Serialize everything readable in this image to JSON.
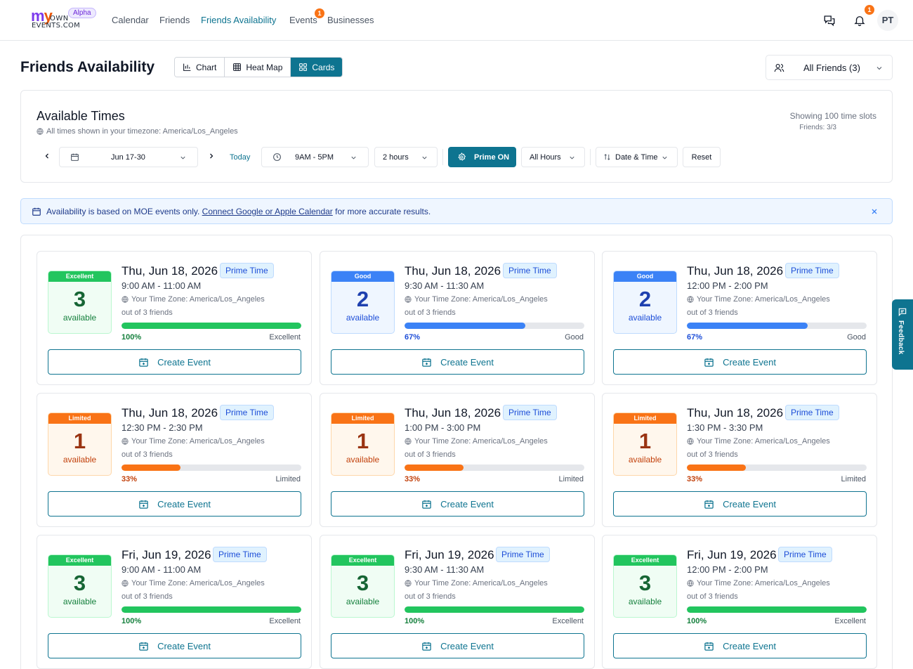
{
  "nav": {
    "logo_brand": "MYOWNEVENTS.COM",
    "logo_own": "OWN",
    "logo_events": "EVENTS.COM",
    "alpha_badge": "Alpha",
    "links": [
      "Calendar",
      "Friends",
      "Friends Availability",
      "Events",
      "Businesses"
    ],
    "active_link": "Friends Availability",
    "events_badge": "1",
    "notifications_badge": "1",
    "avatar_initials": "PT"
  },
  "header": {
    "title": "Friends Availability",
    "views": [
      "Chart",
      "Heat Map",
      "Cards"
    ],
    "active_view": "Cards",
    "friends_filter": "All Friends (3)"
  },
  "panel": {
    "title": "Available Times",
    "timezone_note": "All times shown in your timezone: America/Los_Angeles",
    "showing": "Showing 100 time slots",
    "friends_count": "Friends: 3/3",
    "date_range": "Jun 17-30",
    "today": "Today",
    "hours_range": "9AM - 5PM",
    "duration": "2 hours",
    "prime": "Prime ON",
    "all_hours": "All Hours",
    "sort": "Date & Time",
    "reset": "Reset"
  },
  "banner": {
    "text_before": "Availability is based on MOE events only. ",
    "link": "Connect Google or Apple Calendar",
    "text_after": " for more accurate results."
  },
  "colors": {
    "accent": "#0e7490",
    "excellent": "#22c55e",
    "good": "#3b82f6",
    "limited": "#f97316"
  },
  "cards": [
    {
      "tier": "Excellent",
      "count": "3",
      "available": "available",
      "date": "Thu, Jun 18, 2026",
      "prime": "Prime Time",
      "time": "9:00 AM - 11:00 AM",
      "tz": "Your Time Zone: America/Los_Angeles",
      "outof": "out of 3 friends",
      "pct": "100%",
      "fill": 1.0,
      "quality": "Excellent",
      "button": "Create Event"
    },
    {
      "tier": "Good",
      "count": "2",
      "available": "available",
      "date": "Thu, Jun 18, 2026",
      "prime": "Prime Time",
      "time": "9:30 AM - 11:30 AM",
      "tz": "Your Time Zone: America/Los_Angeles",
      "outof": "out of 3 friends",
      "pct": "67%",
      "fill": 0.67,
      "quality": "Good",
      "button": "Create Event"
    },
    {
      "tier": "Good",
      "count": "2",
      "available": "available",
      "date": "Thu, Jun 18, 2026",
      "prime": "Prime Time",
      "time": "12:00 PM - 2:00 PM",
      "tz": "Your Time Zone: America/Los_Angeles",
      "outof": "out of 3 friends",
      "pct": "67%",
      "fill": 0.67,
      "quality": "Good",
      "button": "Create Event"
    },
    {
      "tier": "Limited",
      "count": "1",
      "available": "available",
      "date": "Thu, Jun 18, 2026",
      "prime": "Prime Time",
      "time": "12:30 PM - 2:30 PM",
      "tz": "Your Time Zone: America/Los_Angeles",
      "outof": "out of 3 friends",
      "pct": "33%",
      "fill": 0.33,
      "quality": "Limited",
      "button": "Create Event"
    },
    {
      "tier": "Limited",
      "count": "1",
      "available": "available",
      "date": "Thu, Jun 18, 2026",
      "prime": "Prime Time",
      "time": "1:00 PM - 3:00 PM",
      "tz": "Your Time Zone: America/Los_Angeles",
      "outof": "out of 3 friends",
      "pct": "33%",
      "fill": 0.33,
      "quality": "Limited",
      "button": "Create Event"
    },
    {
      "tier": "Limited",
      "count": "1",
      "available": "available",
      "date": "Thu, Jun 18, 2026",
      "prime": "Prime Time",
      "time": "1:30 PM - 3:30 PM",
      "tz": "Your Time Zone: America/Los_Angeles",
      "outof": "out of 3 friends",
      "pct": "33%",
      "fill": 0.33,
      "quality": "Limited",
      "button": "Create Event"
    },
    {
      "tier": "Excellent",
      "count": "3",
      "available": "available",
      "date": "Fri, Jun 19, 2026",
      "prime": "Prime Time",
      "time": "9:00 AM - 11:00 AM",
      "tz": "Your Time Zone: America/Los_Angeles",
      "outof": "out of 3 friends",
      "pct": "100%",
      "fill": 1.0,
      "quality": "Excellent",
      "button": "Create Event"
    },
    {
      "tier": "Excellent",
      "count": "3",
      "available": "available",
      "date": "Fri, Jun 19, 2026",
      "prime": "Prime Time",
      "time": "9:30 AM - 11:30 AM",
      "tz": "Your Time Zone: America/Los_Angeles",
      "outof": "out of 3 friends",
      "pct": "100%",
      "fill": 1.0,
      "quality": "Excellent",
      "button": "Create Event"
    },
    {
      "tier": "Excellent",
      "count": "3",
      "available": "available",
      "date": "Fri, Jun 19, 2026",
      "prime": "Prime Time",
      "time": "12:00 PM - 2:00 PM",
      "tz": "Your Time Zone: America/Los_Angeles",
      "outof": "out of 3 friends",
      "pct": "100%",
      "fill": 1.0,
      "quality": "Excellent",
      "button": "Create Event"
    }
  ],
  "feedback": "Feedback"
}
